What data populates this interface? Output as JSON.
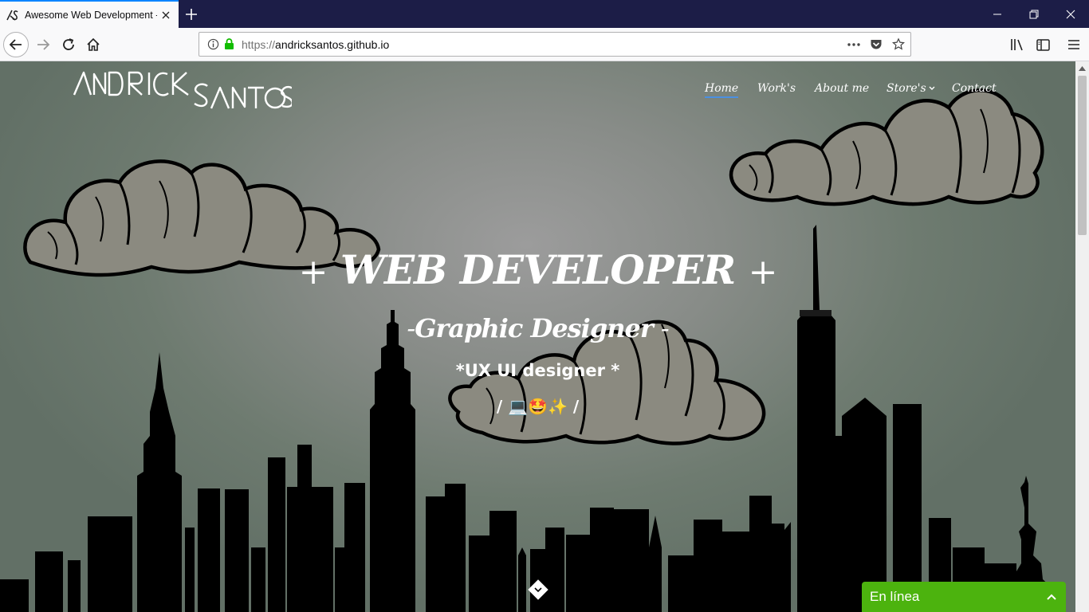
{
  "browser": {
    "tab": {
      "title": "Awesome Web Development -"
    },
    "url": {
      "protocol": "https://",
      "host": "andricksantos.github.io"
    }
  },
  "site": {
    "logo": {
      "line1": "ANDRICK",
      "line2": "SANTOS"
    },
    "nav": [
      {
        "label": "Home",
        "active": true
      },
      {
        "label": "Work's"
      },
      {
        "label": "About me"
      },
      {
        "label": "Store's",
        "dropdown": true
      },
      {
        "label": "Contact"
      }
    ],
    "hero": {
      "title": "WEB DEVELOPER",
      "title_prefix": "+",
      "title_suffix": "+",
      "subtitle": "Graphic Designer",
      "subtitle_prefix": "-",
      "subtitle_suffix": "-",
      "role": "*UX UI designer *",
      "emoji_prefix": "/",
      "emojis": "💻🤩✨",
      "emoji_suffix": "/"
    }
  },
  "chat": {
    "label": "En línea"
  },
  "colors": {
    "accent": "#0a84ff",
    "chat": "#4cb30e",
    "nav_active": "#4a90e2"
  }
}
